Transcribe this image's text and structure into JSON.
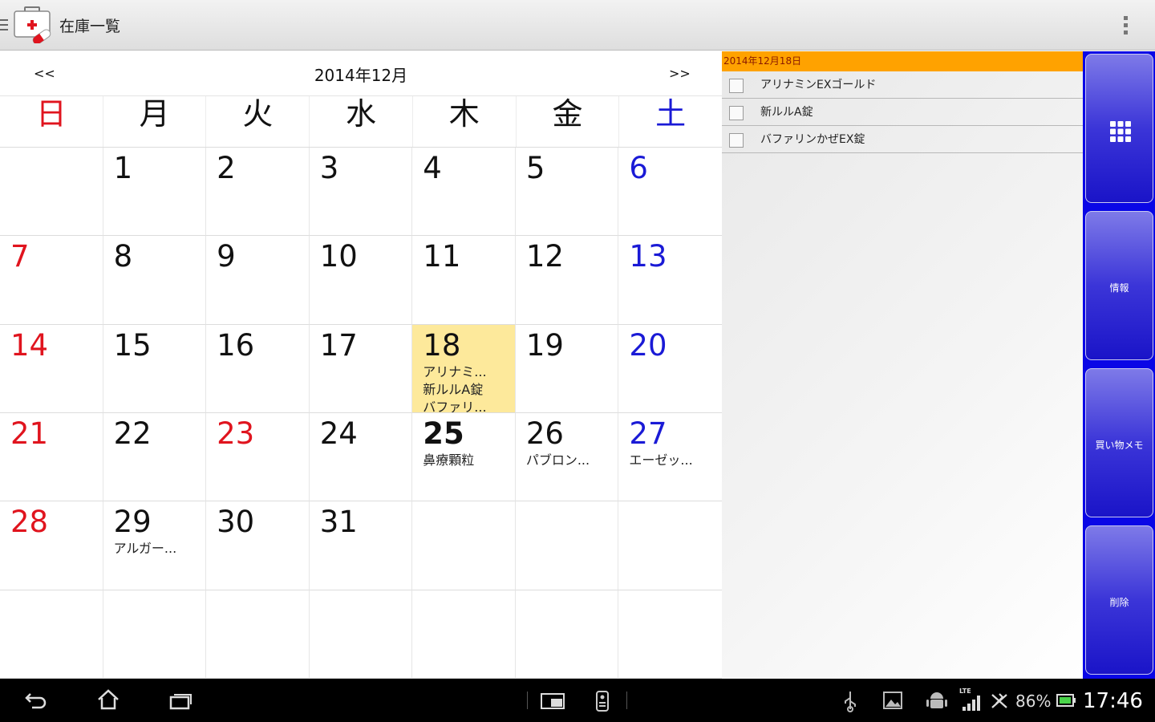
{
  "app": {
    "title": "在庫一覧"
  },
  "calendar": {
    "prev_label": "<<",
    "next_label": ">>",
    "month_title": "2014年12月",
    "weekdays": [
      "日",
      "月",
      "火",
      "水",
      "木",
      "金",
      "土"
    ],
    "weeks": [
      [
        {
          "day": ""
        },
        {
          "day": "1"
        },
        {
          "day": "2"
        },
        {
          "day": "3"
        },
        {
          "day": "4"
        },
        {
          "day": "5"
        },
        {
          "day": "6"
        }
      ],
      [
        {
          "day": "7"
        },
        {
          "day": "8"
        },
        {
          "day": "9"
        },
        {
          "day": "10"
        },
        {
          "day": "11"
        },
        {
          "day": "12"
        },
        {
          "day": "13"
        }
      ],
      [
        {
          "day": "14"
        },
        {
          "day": "15"
        },
        {
          "day": "16"
        },
        {
          "day": "17"
        },
        {
          "day": "18",
          "events": [
            "アリナミ...",
            "新ルルA錠",
            "バファリ..."
          ]
        },
        {
          "day": "19"
        },
        {
          "day": "20"
        }
      ],
      [
        {
          "day": "21"
        },
        {
          "day": "22"
        },
        {
          "day": "23"
        },
        {
          "day": "24"
        },
        {
          "day": "25",
          "events": [
            "鼻療顆粒"
          ]
        },
        {
          "day": "26",
          "events": [
            "パブロン..."
          ]
        },
        {
          "day": "27",
          "events": [
            "エーゼッ..."
          ]
        }
      ],
      [
        {
          "day": "28"
        },
        {
          "day": "29",
          "events": [
            "アルガー..."
          ]
        },
        {
          "day": "30"
        },
        {
          "day": "31"
        },
        {
          "day": ""
        },
        {
          "day": ""
        },
        {
          "day": ""
        }
      ],
      [
        {
          "day": ""
        },
        {
          "day": ""
        },
        {
          "day": ""
        },
        {
          "day": ""
        },
        {
          "day": ""
        },
        {
          "day": ""
        },
        {
          "day": ""
        }
      ]
    ],
    "holiday_days": [
      "23"
    ],
    "today": "18",
    "bold_day": "25"
  },
  "side": {
    "date_header": "2014年12月18日",
    "items": [
      {
        "label": "アリナミンEXゴールド",
        "checked": false
      },
      {
        "label": "新ルルA錠",
        "checked": false
      },
      {
        "label": "バファリンかぜEX錠",
        "checked": false
      }
    ]
  },
  "rail": {
    "info_label": "情報",
    "shopping_label": "買い物メモ",
    "delete_label": "削除"
  },
  "status": {
    "battery": "86%",
    "time": "17:46",
    "network": "LTE"
  },
  "colors": {
    "sunday": "#e0141e",
    "saturday": "#1a1ad6",
    "today_bg": "#fde99b",
    "header_orange": "#ffa200",
    "rail_blue": "#0a07e6"
  }
}
